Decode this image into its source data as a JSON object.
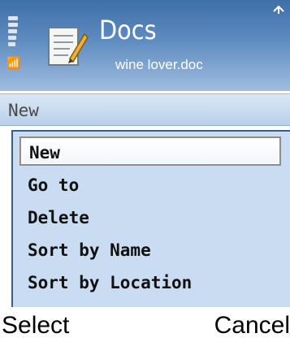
{
  "header": {
    "app_title": "Docs",
    "file_name": "wine lover.doc",
    "icons": [
      "signal-strength-icon",
      "antenna-icon",
      "document-icon",
      "top-right-indicator-icon"
    ]
  },
  "field": {
    "value": "New"
  },
  "menu": {
    "items": [
      {
        "label": "New",
        "selected": true
      },
      {
        "label": "Go to",
        "selected": false
      },
      {
        "label": "Delete",
        "selected": false
      },
      {
        "label": "Sort by Name",
        "selected": false
      },
      {
        "label": "Sort by Location",
        "selected": false
      }
    ]
  },
  "softkeys": {
    "left": "Select",
    "right": "Cancel"
  },
  "colors": {
    "header_top": "#3f6fa8",
    "menu_bg": "#c9dcf1",
    "selection_border": "#8d8d8d"
  }
}
